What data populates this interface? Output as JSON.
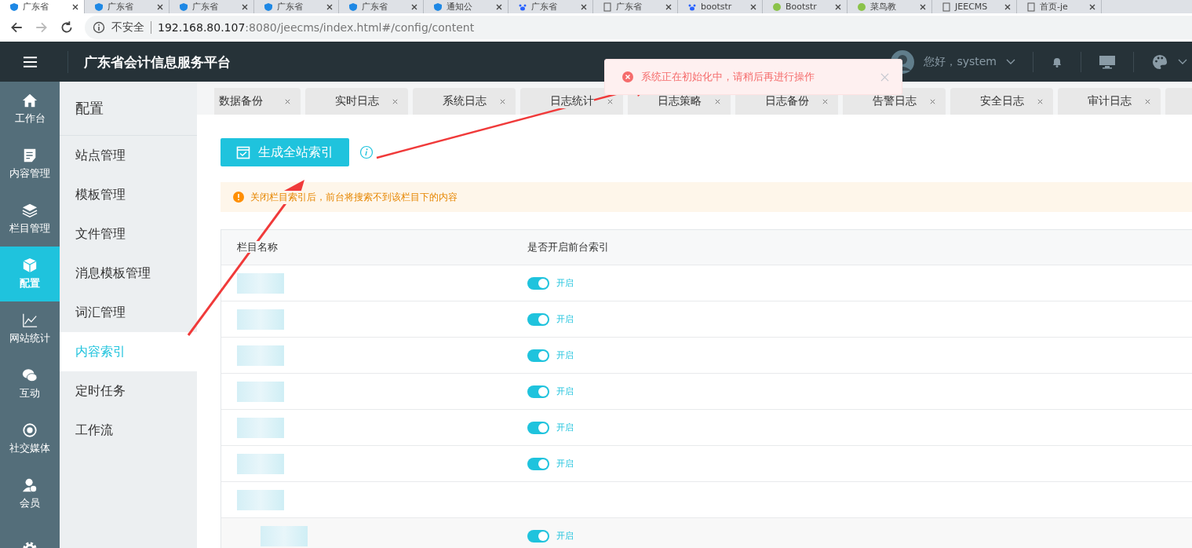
{
  "browser": {
    "tabs": [
      {
        "title": "广东省",
        "selected": true
      },
      {
        "title": "广东省",
        "selected": false
      },
      {
        "title": "广东省",
        "selected": false
      },
      {
        "title": "广东省",
        "selected": false
      },
      {
        "title": "广东省",
        "selected": false
      },
      {
        "title": "通知公",
        "selected": false
      },
      {
        "title": "广东省",
        "selected": false
      },
      {
        "title": "广东省",
        "selected": false
      },
      {
        "title": "bootstr",
        "selected": false
      },
      {
        "title": "Bootstr",
        "selected": false
      },
      {
        "title": "菜鸟教",
        "selected": false
      },
      {
        "title": "JEECMS",
        "selected": false
      },
      {
        "title": "首页-je",
        "selected": false
      }
    ],
    "security": "不安全",
    "host": "192.168.80.107",
    "path": ":8080/jeecms/index.html#/config/content"
  },
  "header": {
    "title": "广东省会计信息服务平台",
    "greeting": "您好，system"
  },
  "toast": {
    "message": "系统正在初始化中，请稍后再进行操作"
  },
  "nav_rail": [
    {
      "label": "工作台",
      "selected": false
    },
    {
      "label": "内容管理",
      "selected": false
    },
    {
      "label": "栏目管理",
      "selected": false
    },
    {
      "label": "配置",
      "selected": true
    },
    {
      "label": "网站统计",
      "selected": false
    },
    {
      "label": "互动",
      "selected": false
    },
    {
      "label": "社交媒体",
      "selected": false
    },
    {
      "label": "会员",
      "selected": false
    }
  ],
  "sub_menu": {
    "title": "配置",
    "items": [
      {
        "label": "站点管理",
        "selected": false
      },
      {
        "label": "模板管理",
        "selected": false
      },
      {
        "label": "文件管理",
        "selected": false
      },
      {
        "label": "消息模板管理",
        "selected": false
      },
      {
        "label": "词汇管理",
        "selected": false
      },
      {
        "label": "内容索引",
        "selected": true
      },
      {
        "label": "定时任务",
        "selected": false
      },
      {
        "label": "工作流",
        "selected": false
      }
    ]
  },
  "page_tabs": [
    "数据备份",
    "实时日志",
    "系统日志",
    "日志统计",
    "日志策略",
    "日志备份",
    "告警日志",
    "安全日志",
    "审计日志"
  ],
  "content": {
    "button": "生成全站索引",
    "notice": "关闭栏目索引后，前台将搜索不到该栏目下的内容",
    "columns": [
      "栏目名称",
      "是否开启前台索引"
    ],
    "rows": [
      {
        "kind": "toggle",
        "on": true,
        "status": "开启"
      },
      {
        "kind": "toggle",
        "on": true,
        "status": "开启"
      },
      {
        "kind": "toggle",
        "on": true,
        "status": "开启"
      },
      {
        "kind": "toggle",
        "on": true,
        "status": "开启"
      },
      {
        "kind": "toggle",
        "on": true,
        "status": "开启"
      },
      {
        "kind": "toggle",
        "on": true,
        "status": "开启"
      },
      {
        "kind": "group",
        "children": [
          {
            "kind": "toggle",
            "on": true,
            "status": "开启"
          }
        ]
      }
    ]
  }
}
